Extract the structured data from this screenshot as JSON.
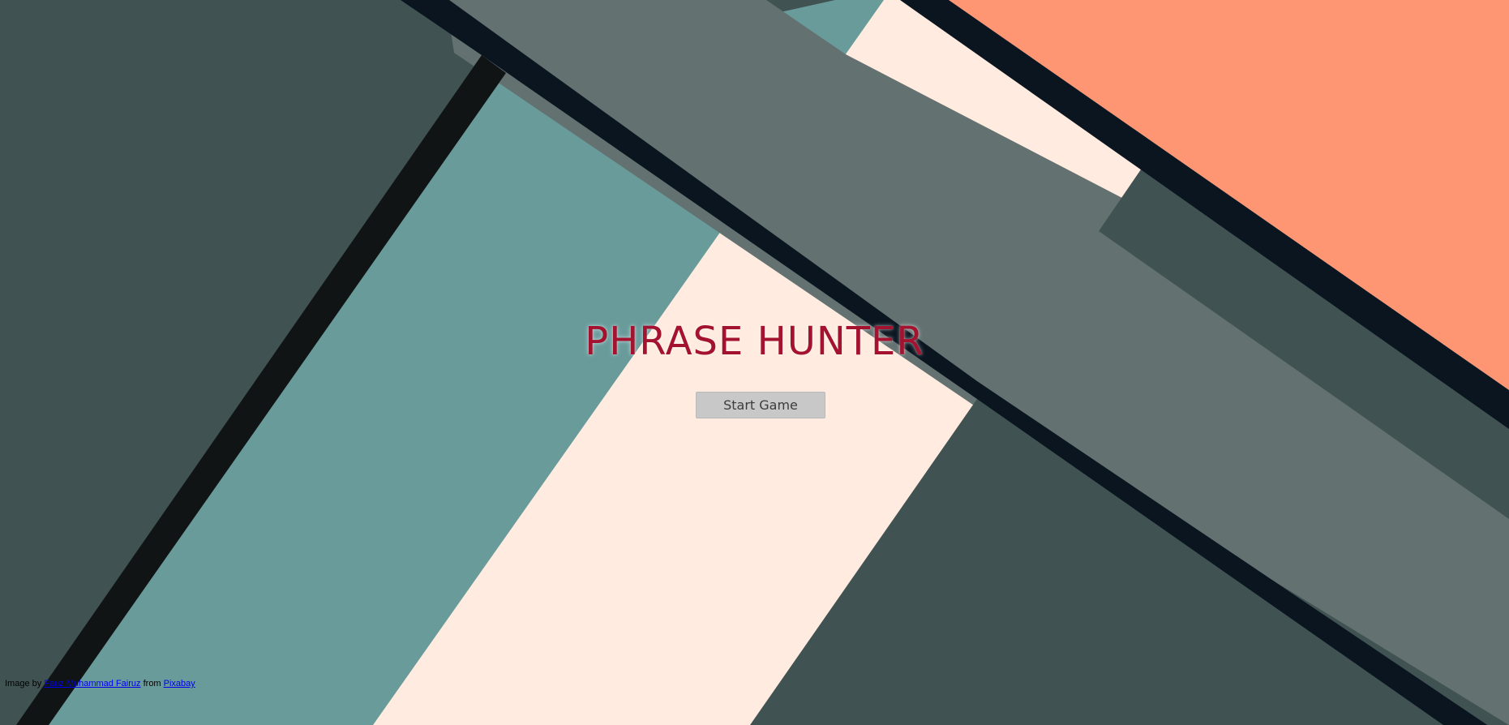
{
  "game": {
    "title": "PHRASE HUNTER",
    "start_label": "Start Game"
  },
  "credit": {
    "prefix": "Image by",
    "author": "Fauz Muhammad Fairuz",
    "middle": "from",
    "source": "Pixabay"
  },
  "colors": {
    "background_dark_slate": "#405352",
    "teal": "#699b9b",
    "cream": "#ffebdf",
    "gray_slate": "#637271",
    "salmon": "#ff9673",
    "navy_stripe": "#0a1520",
    "black_stripe": "#101414",
    "title_red": "#a3132f",
    "button_bg": "#c8c8c8",
    "button_text": "#3c3c3c"
  }
}
